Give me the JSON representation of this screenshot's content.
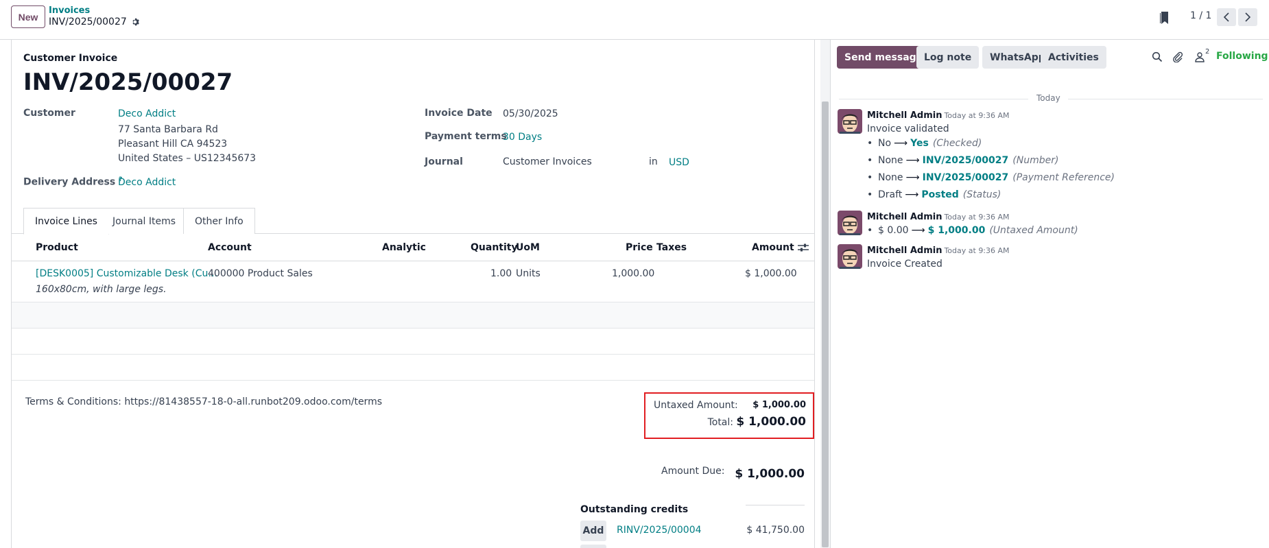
{
  "topbar": {
    "new_label": "New",
    "breadcrumb_parent": "Invoices",
    "breadcrumb_current": "INV/2025/00027",
    "pager": "1 / 1"
  },
  "form": {
    "doc_type": "Customer Invoice",
    "doc_name": "INV/2025/00027",
    "customer_label": "Customer",
    "customer_name": "Deco Addict",
    "address_line1": "77 Santa Barbara Rd",
    "address_line2": "Pleasant Hill CA 94523",
    "address_line3": "United States – US12345673",
    "delivery_label": "Delivery Address",
    "delivery_help": "?",
    "delivery_value": "Deco Addict",
    "invoice_date_label": "Invoice Date",
    "invoice_date": "05/30/2025",
    "payment_terms_label": "Payment terms",
    "payment_terms": "30 Days",
    "journal_label": "Journal",
    "journal": "Customer Invoices",
    "currency_in": "in",
    "currency": "USD"
  },
  "tabs": [
    "Invoice Lines",
    "Journal Items",
    "Other Info"
  ],
  "table": {
    "headers": {
      "product": "Product",
      "account": "Account",
      "analytic": "Analytic",
      "quantity": "Quantity",
      "uom": "UoM",
      "price": "Price",
      "taxes": "Taxes",
      "amount": "Amount"
    },
    "rows": [
      {
        "product": "[DESK0005] Customizable Desk (Cu…",
        "description": "160x80cm, with large legs.",
        "account": "400000 Product Sales",
        "analytic": "",
        "quantity": "1.00",
        "uom": "Units",
        "price": "1,000.00",
        "taxes": "",
        "amount": "$ 1,000.00"
      }
    ]
  },
  "footer": {
    "terms": "Terms & Conditions: https://81438557-18-0-all.runbot209.odoo.com/terms",
    "untaxed_label": "Untaxed Amount:",
    "untaxed_value": "$ 1,000.00",
    "total_label": "Total:",
    "total_value": "$ 1,000.00",
    "amount_due_label": "Amount Due:",
    "amount_due_value": "$ 1,000.00",
    "outstanding_title": "Outstanding credits",
    "add_label": "Add",
    "credit_ref": "RINV/2025/00004",
    "credit_amount": "$ 41,750.00"
  },
  "chatter": {
    "send_message": "Send message",
    "log_note": "Log note",
    "whatsapp": "WhatsApp",
    "activities": "Activities",
    "followers_count": "2",
    "following": "Following",
    "today": "Today",
    "messages": [
      {
        "author": "Mitchell Admin",
        "time": "Today at 9:36 AM",
        "body": "Invoice validated",
        "changes": [
          {
            "old": "No",
            "new": "Yes",
            "field": "(Checked)"
          },
          {
            "old": "None",
            "new": "INV/2025/00027",
            "field": "(Number)"
          },
          {
            "old": "None",
            "new": "INV/2025/00027",
            "field": "(Payment Reference)"
          },
          {
            "old": "Draft",
            "new": "Posted",
            "field": "(Status)"
          }
        ]
      },
      {
        "author": "Mitchell Admin",
        "time": "Today at 9:36 AM",
        "body": "",
        "changes": [
          {
            "old": "$ 0.00",
            "new": "$ 1,000.00",
            "field": "(Untaxed Amount)"
          }
        ]
      },
      {
        "author": "Mitchell Admin",
        "time": "Today at 9:36 AM",
        "body": "Invoice Created",
        "changes": []
      }
    ]
  }
}
